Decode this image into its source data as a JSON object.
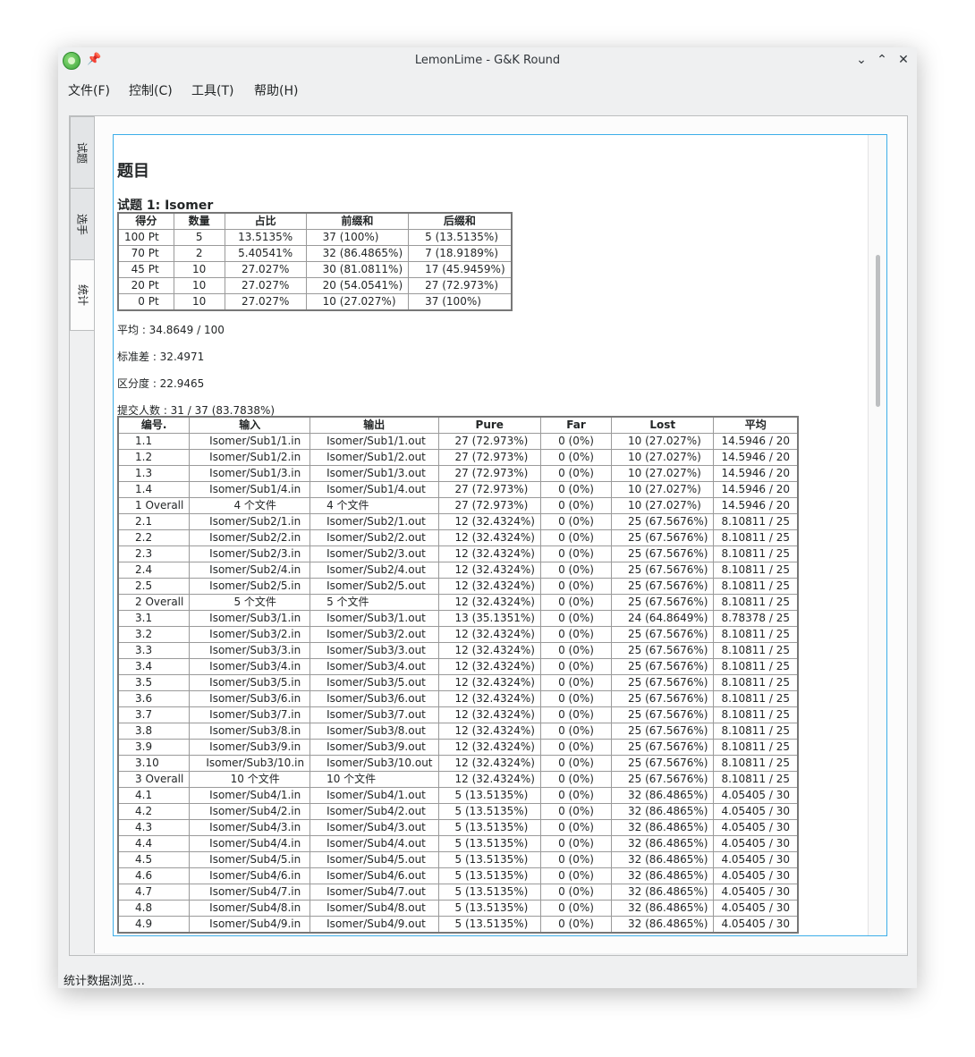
{
  "window": {
    "title": "LemonLime - G&K Round",
    "icon": "lemon-app-icon"
  },
  "menu": [
    "文件(F)",
    "控制(C)",
    "工具(T)",
    "帮助(H)"
  ],
  "tabs": [
    "试题",
    "选手",
    "统计"
  ],
  "active_tab": "统计",
  "content": {
    "heading": "题目",
    "problem_title": "试题 1: Isomer",
    "score_headers": [
      "得分",
      "数量",
      "占比",
      "前缀和",
      "后缀和"
    ],
    "score_rows": [
      [
        "100 Pt",
        "5",
        "13.5135%",
        "37 (100%)",
        "5 (13.5135%)"
      ],
      [
        "70 Pt",
        "2",
        "5.40541%",
        "32 (86.4865%)",
        "7 (18.9189%)"
      ],
      [
        "45 Pt",
        "10",
        "27.027%",
        "30 (81.0811%)",
        "17 (45.9459%)"
      ],
      [
        "20 Pt",
        "10",
        "27.027%",
        "20 (54.0541%)",
        "27 (72.973%)"
      ],
      [
        "0 Pt",
        "10",
        "27.027%",
        "10 (27.027%)",
        "37 (100%)"
      ]
    ],
    "average": "平均 : 34.8649 / 100",
    "stddev": "标准差 : 32.4971",
    "discrimination": "区分度 : 22.9465",
    "submitted": "提交人数 : 31 / 37 (83.7838%)",
    "case_headers": [
      "编号.",
      "输入",
      "输出",
      "Pure",
      "Far",
      "Lost",
      "平均"
    ],
    "case_rows": [
      [
        "1.1",
        "Isomer/Sub1/1.in",
        "Isomer/Sub1/1.out",
        "27 (72.973%)",
        "0 (0%)",
        "10 (27.027%)",
        "14.5946 / 20"
      ],
      [
        "1.2",
        "Isomer/Sub1/2.in",
        "Isomer/Sub1/2.out",
        "27 (72.973%)",
        "0 (0%)",
        "10 (27.027%)",
        "14.5946 / 20"
      ],
      [
        "1.3",
        "Isomer/Sub1/3.in",
        "Isomer/Sub1/3.out",
        "27 (72.973%)",
        "0 (0%)",
        "10 (27.027%)",
        "14.5946 / 20"
      ],
      [
        "1.4",
        "Isomer/Sub1/4.in",
        "Isomer/Sub1/4.out",
        "27 (72.973%)",
        "0 (0%)",
        "10 (27.027%)",
        "14.5946 / 20"
      ],
      [
        "1 Overall",
        "4 个文件",
        "4 个文件",
        "27 (72.973%)",
        "0 (0%)",
        "10 (27.027%)",
        "14.5946 / 20"
      ],
      [
        "2.1",
        "Isomer/Sub2/1.in",
        "Isomer/Sub2/1.out",
        "12 (32.4324%)",
        "0 (0%)",
        "25 (67.5676%)",
        "8.10811 / 25"
      ],
      [
        "2.2",
        "Isomer/Sub2/2.in",
        "Isomer/Sub2/2.out",
        "12 (32.4324%)",
        "0 (0%)",
        "25 (67.5676%)",
        "8.10811 / 25"
      ],
      [
        "2.3",
        "Isomer/Sub2/3.in",
        "Isomer/Sub2/3.out",
        "12 (32.4324%)",
        "0 (0%)",
        "25 (67.5676%)",
        "8.10811 / 25"
      ],
      [
        "2.4",
        "Isomer/Sub2/4.in",
        "Isomer/Sub2/4.out",
        "12 (32.4324%)",
        "0 (0%)",
        "25 (67.5676%)",
        "8.10811 / 25"
      ],
      [
        "2.5",
        "Isomer/Sub2/5.in",
        "Isomer/Sub2/5.out",
        "12 (32.4324%)",
        "0 (0%)",
        "25 (67.5676%)",
        "8.10811 / 25"
      ],
      [
        "2 Overall",
        "5 个文件",
        "5 个文件",
        "12 (32.4324%)",
        "0 (0%)",
        "25 (67.5676%)",
        "8.10811 / 25"
      ],
      [
        "3.1",
        "Isomer/Sub3/1.in",
        "Isomer/Sub3/1.out",
        "13 (35.1351%)",
        "0 (0%)",
        "24 (64.8649%)",
        "8.78378 / 25"
      ],
      [
        "3.2",
        "Isomer/Sub3/2.in",
        "Isomer/Sub3/2.out",
        "12 (32.4324%)",
        "0 (0%)",
        "25 (67.5676%)",
        "8.10811 / 25"
      ],
      [
        "3.3",
        "Isomer/Sub3/3.in",
        "Isomer/Sub3/3.out",
        "12 (32.4324%)",
        "0 (0%)",
        "25 (67.5676%)",
        "8.10811 / 25"
      ],
      [
        "3.4",
        "Isomer/Sub3/4.in",
        "Isomer/Sub3/4.out",
        "12 (32.4324%)",
        "0 (0%)",
        "25 (67.5676%)",
        "8.10811 / 25"
      ],
      [
        "3.5",
        "Isomer/Sub3/5.in",
        "Isomer/Sub3/5.out",
        "12 (32.4324%)",
        "0 (0%)",
        "25 (67.5676%)",
        "8.10811 / 25"
      ],
      [
        "3.6",
        "Isomer/Sub3/6.in",
        "Isomer/Sub3/6.out",
        "12 (32.4324%)",
        "0 (0%)",
        "25 (67.5676%)",
        "8.10811 / 25"
      ],
      [
        "3.7",
        "Isomer/Sub3/7.in",
        "Isomer/Sub3/7.out",
        "12 (32.4324%)",
        "0 (0%)",
        "25 (67.5676%)",
        "8.10811 / 25"
      ],
      [
        "3.8",
        "Isomer/Sub3/8.in",
        "Isomer/Sub3/8.out",
        "12 (32.4324%)",
        "0 (0%)",
        "25 (67.5676%)",
        "8.10811 / 25"
      ],
      [
        "3.9",
        "Isomer/Sub3/9.in",
        "Isomer/Sub3/9.out",
        "12 (32.4324%)",
        "0 (0%)",
        "25 (67.5676%)",
        "8.10811 / 25"
      ],
      [
        "3.10",
        "Isomer/Sub3/10.in",
        "Isomer/Sub3/10.out",
        "12 (32.4324%)",
        "0 (0%)",
        "25 (67.5676%)",
        "8.10811 / 25"
      ],
      [
        "3 Overall",
        "10 个文件",
        "10 个文件",
        "12 (32.4324%)",
        "0 (0%)",
        "25 (67.5676%)",
        "8.10811 / 25"
      ],
      [
        "4.1",
        "Isomer/Sub4/1.in",
        "Isomer/Sub4/1.out",
        "5 (13.5135%)",
        "0 (0%)",
        "32 (86.4865%)",
        "4.05405 / 30"
      ],
      [
        "4.2",
        "Isomer/Sub4/2.in",
        "Isomer/Sub4/2.out",
        "5 (13.5135%)",
        "0 (0%)",
        "32 (86.4865%)",
        "4.05405 / 30"
      ],
      [
        "4.3",
        "Isomer/Sub4/3.in",
        "Isomer/Sub4/3.out",
        "5 (13.5135%)",
        "0 (0%)",
        "32 (86.4865%)",
        "4.05405 / 30"
      ],
      [
        "4.4",
        "Isomer/Sub4/4.in",
        "Isomer/Sub4/4.out",
        "5 (13.5135%)",
        "0 (0%)",
        "32 (86.4865%)",
        "4.05405 / 30"
      ],
      [
        "4.5",
        "Isomer/Sub4/5.in",
        "Isomer/Sub4/5.out",
        "5 (13.5135%)",
        "0 (0%)",
        "32 (86.4865%)",
        "4.05405 / 30"
      ],
      [
        "4.6",
        "Isomer/Sub4/6.in",
        "Isomer/Sub4/6.out",
        "5 (13.5135%)",
        "0 (0%)",
        "32 (86.4865%)",
        "4.05405 / 30"
      ],
      [
        "4.7",
        "Isomer/Sub4/7.in",
        "Isomer/Sub4/7.out",
        "5 (13.5135%)",
        "0 (0%)",
        "32 (86.4865%)",
        "4.05405 / 30"
      ],
      [
        "4.8",
        "Isomer/Sub4/8.in",
        "Isomer/Sub4/8.out",
        "5 (13.5135%)",
        "0 (0%)",
        "32 (86.4865%)",
        "4.05405 / 30"
      ],
      [
        "4.9",
        "Isomer/Sub4/9.in",
        "Isomer/Sub4/9.out",
        "5 (13.5135%)",
        "0 (0%)",
        "32 (86.4865%)",
        "4.05405 / 30"
      ]
    ]
  },
  "status_text": "统计数据浏览…",
  "colors": {
    "focus_border": "#3daee9",
    "window_bg": "#eff0f1"
  }
}
